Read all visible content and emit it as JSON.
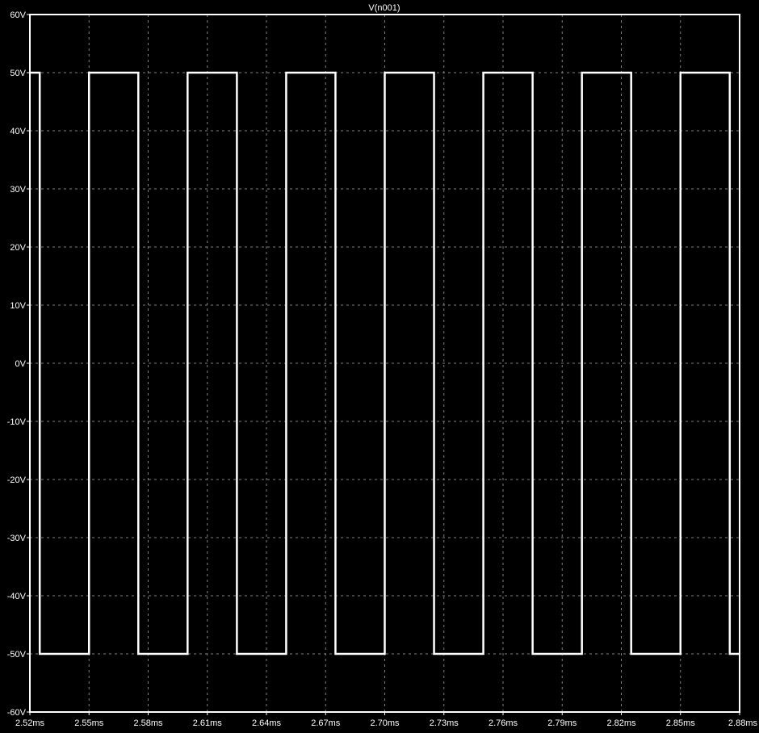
{
  "colors": {
    "background": "#000000",
    "frame": "#ffffff",
    "grid": "#808080",
    "trace": "#ffffff"
  },
  "chart_data": {
    "type": "line",
    "title": "V(n001)",
    "xlabel": "",
    "ylabel": "",
    "xlim": [
      2.52,
      2.88
    ],
    "ylim": [
      -60,
      60
    ],
    "x_unit": "ms",
    "y_unit": "V",
    "grid": true,
    "legend": "none",
    "x_ticks": [
      2.52,
      2.55,
      2.58,
      2.61,
      2.64,
      2.67,
      2.7,
      2.73,
      2.76,
      2.79,
      2.82,
      2.85,
      2.88
    ],
    "x_tick_labels": [
      "2.52ms",
      "2.55ms",
      "2.58ms",
      "2.61ms",
      "2.64ms",
      "2.67ms",
      "2.70ms",
      "2.73ms",
      "2.76ms",
      "2.79ms",
      "2.82ms",
      "2.85ms",
      "2.88ms"
    ],
    "y_ticks": [
      60,
      50,
      40,
      30,
      20,
      10,
      0,
      -10,
      -20,
      -30,
      -40,
      -50,
      -60
    ],
    "y_tick_labels": [
      "60V",
      "50V",
      "40V",
      "30V",
      "20V",
      "10V",
      "0V",
      "-10V",
      "-20V",
      "-30V",
      "-40V",
      "-50V",
      "-60V"
    ],
    "series": [
      {
        "name": "V(n001)",
        "x": [
          2.52,
          2.525,
          2.525,
          2.55,
          2.55,
          2.575,
          2.575,
          2.6,
          2.6,
          2.625,
          2.625,
          2.65,
          2.65,
          2.675,
          2.675,
          2.7,
          2.7,
          2.725,
          2.725,
          2.75,
          2.75,
          2.775,
          2.775,
          2.8,
          2.8,
          2.825,
          2.825,
          2.85,
          2.85,
          2.875,
          2.875,
          2.88
        ],
        "y": [
          50,
          50,
          -50,
          -50,
          50,
          50,
          -50,
          -50,
          50,
          50,
          -50,
          -50,
          50,
          50,
          -50,
          -50,
          50,
          50,
          -50,
          -50,
          50,
          50,
          -50,
          -50,
          50,
          50,
          -50,
          -50,
          50,
          50,
          -50,
          -50
        ]
      }
    ]
  }
}
